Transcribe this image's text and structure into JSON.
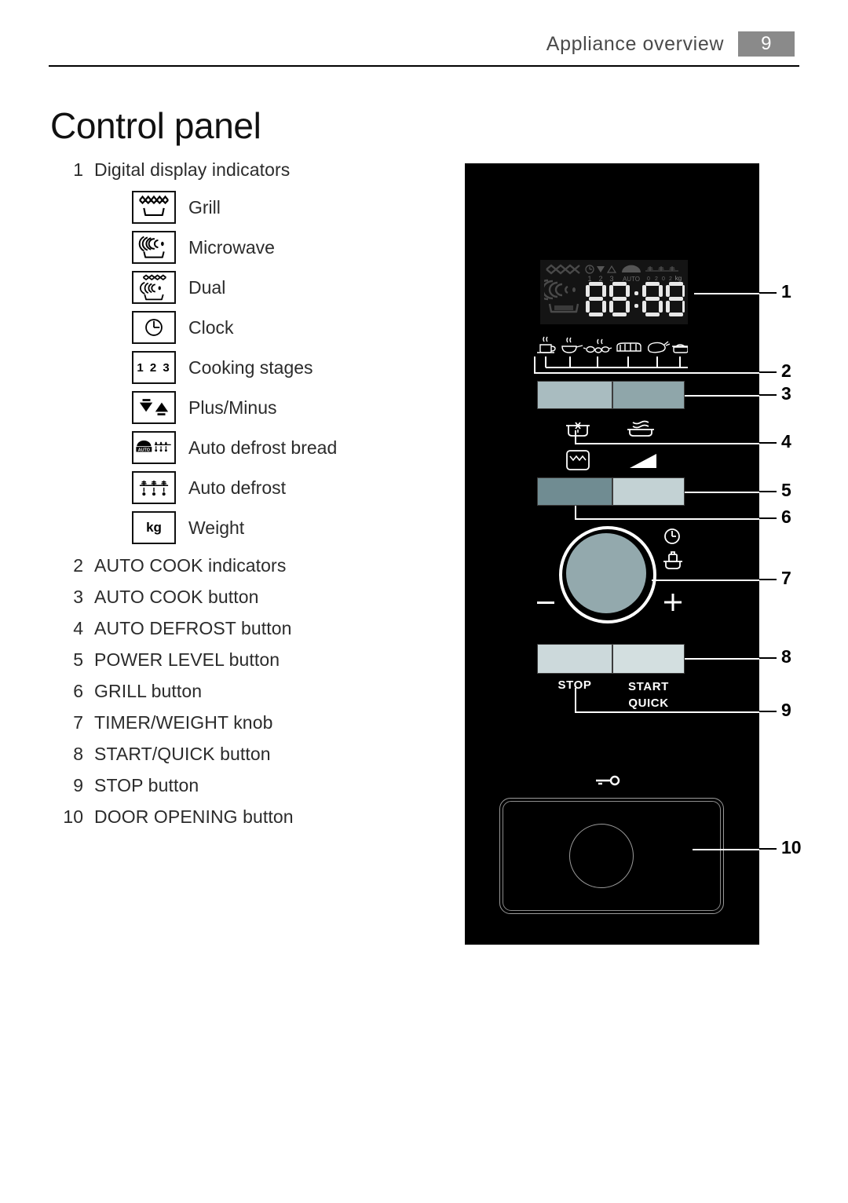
{
  "header": {
    "title": "Appliance overview",
    "page_number": "9"
  },
  "doc": {
    "title": "Control panel"
  },
  "list": {
    "item1": {
      "num": "1",
      "label": "Digital display indicators"
    },
    "indicators": [
      {
        "icon": "grill-icon",
        "label": "Grill"
      },
      {
        "icon": "microwave-icon",
        "label": "Microwave"
      },
      {
        "icon": "dual-icon",
        "label": "Dual"
      },
      {
        "icon": "clock-icon",
        "label": "Clock"
      },
      {
        "icon": "cooking-stages-icon",
        "label": "Cooking stages",
        "text": "1 2 3"
      },
      {
        "icon": "plus-minus-icon",
        "label": "Plus/Minus"
      },
      {
        "icon": "auto-defrost-bread-icon",
        "label": "Auto defrost bread",
        "text": "AUTO"
      },
      {
        "icon": "auto-defrost-icon",
        "label": "Auto defrost"
      },
      {
        "icon": "weight-icon",
        "label": "Weight",
        "text": "kg"
      }
    ],
    "items": [
      {
        "num": "2",
        "label": "AUTO COOK indicators"
      },
      {
        "num": "3",
        "label": "AUTO COOK button"
      },
      {
        "num": "4",
        "label": "AUTO DEFROST button"
      },
      {
        "num": "5",
        "label": "POWER LEVEL button"
      },
      {
        "num": "6",
        "label": "GRILL button"
      },
      {
        "num": "7",
        "label": "TIMER/WEIGHT knob"
      },
      {
        "num": "8",
        "label": "START/QUICK button"
      },
      {
        "num": "9",
        "label": "STOP button"
      },
      {
        "num": "10",
        "label": "DOOR OPENING button"
      }
    ]
  },
  "panel": {
    "display": {
      "digits": "88:88",
      "stage_numbers": "1 2 3",
      "auto_label": "AUTO",
      "weight_unit": "kg"
    },
    "buttons": {
      "stop_label": "STOP",
      "start_label": "START",
      "quick_label": "QUICK"
    },
    "colors": {
      "panel_bg": "#000000",
      "autocook_left": "#a9bcc0",
      "autocook_right": "#8fa6aa",
      "grill_button": "#708c92",
      "power_button": "#c3d2d4",
      "stop_button": "#ccd9db",
      "start_button": "#d3dfe0",
      "knob_face": "#93a9ad",
      "page_badge": "#8a8a8a"
    }
  },
  "callouts": [
    {
      "num": "1",
      "target": "digital-display"
    },
    {
      "num": "2",
      "target": "auto-cook-indicators"
    },
    {
      "num": "3",
      "target": "auto-cook-button"
    },
    {
      "num": "4",
      "target": "auto-defrost-button"
    },
    {
      "num": "5",
      "target": "power-level-button"
    },
    {
      "num": "6",
      "target": "grill-button"
    },
    {
      "num": "7",
      "target": "timer-weight-knob"
    },
    {
      "num": "8",
      "target": "start-quick-button"
    },
    {
      "num": "9",
      "target": "stop-button"
    },
    {
      "num": "10",
      "target": "door-opening-button"
    }
  ]
}
